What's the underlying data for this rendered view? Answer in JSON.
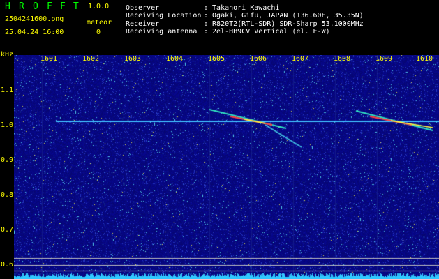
{
  "header": {
    "title_letters": [
      "H",
      "R",
      "O",
      "F",
      "F",
      "T"
    ],
    "version": "1.0.0",
    "filename": "2504241600.png",
    "meteor_label": "meteor",
    "meteor_count": "0",
    "datetime": "25.04.24 16:00"
  },
  "info": {
    "observer_label": "Observer",
    "observer_value": ": Takanori Kawachi",
    "location_label": "Receiving Location",
    "location_value": ": Ogaki, Gifu, JAPAN (136.60E, 35.35N)",
    "receiver_label": "Receiver",
    "receiver_value": ": R820T2(RTL-SDR) SDR-Sharp 53.1000MHz",
    "antenna_label": "Receiving antenna",
    "antenna_value": ": 2el-HB9CV Vertical (el. E-W)"
  },
  "axis": {
    "y_unit": "kHz",
    "y_labels": [
      "1.1",
      "1.0",
      "0.9",
      "0.8",
      "0.7",
      "0.6"
    ],
    "x_labels": [
      "1601",
      "1602",
      "1603",
      "1604",
      "1605",
      "1606",
      "1607",
      "1608",
      "1609",
      "1610"
    ]
  },
  "colors": {
    "background": "#000000",
    "noise_base": "#0a0a7a",
    "carrier": "#40c0ff",
    "meteor_hot": "#ff4040",
    "label_yellow": "#ffff00",
    "title_green": "#00ff00"
  }
}
